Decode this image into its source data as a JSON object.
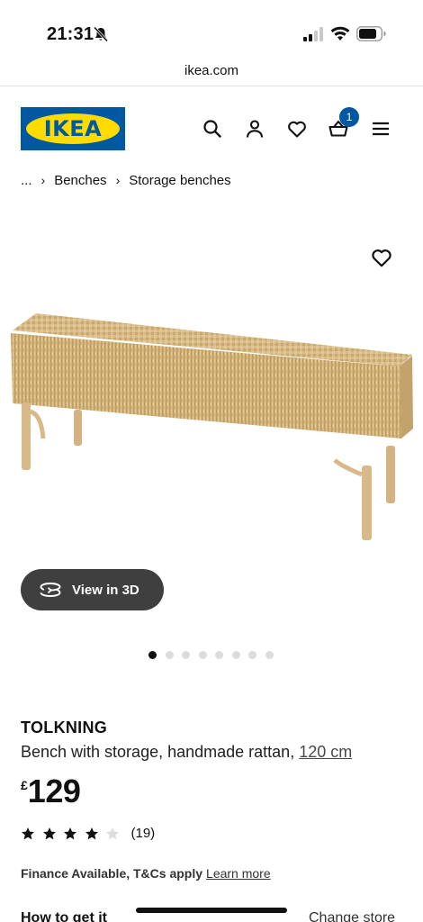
{
  "status_bar": {
    "time": "21:31"
  },
  "browser": {
    "url": "ikea.com"
  },
  "header": {
    "logo_text": "IKEA",
    "basket_count": "1"
  },
  "breadcrumb": {
    "items": [
      "...",
      "Benches",
      "Storage benches"
    ]
  },
  "gallery": {
    "view3d_label": "View in 3D",
    "dot_count": 8,
    "active_index": 0
  },
  "product": {
    "name": "TOLKNING",
    "description": "Bench with storage, handmade rattan,",
    "size_link": "120 cm",
    "price_currency": "£",
    "price_value": "129",
    "rating": 4,
    "rating_max": 5,
    "review_count": "(19)",
    "finance_text": "Finance Available, T&Cs apply",
    "finance_link": "Learn more"
  },
  "fulfilment": {
    "title": "How to get it",
    "change_store": "Change store"
  },
  "colors": {
    "ikea_blue": "#0058a3",
    "ikea_yellow": "#ffdb00",
    "rattan": "#d4b47d"
  }
}
